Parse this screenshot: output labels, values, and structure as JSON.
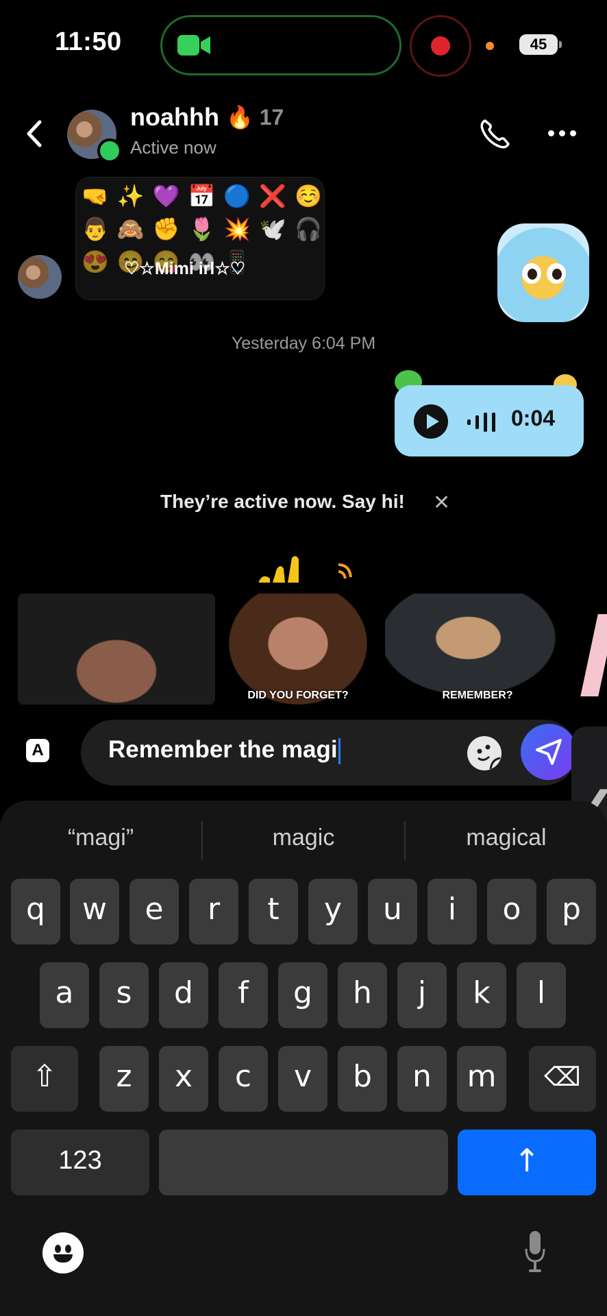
{
  "status_bar": {
    "time": "11:50",
    "battery": "45"
  },
  "header": {
    "name": "noahhh",
    "streak": "🔥 17",
    "status": "Active now"
  },
  "messages": {
    "shared_card_title": "♡☆Mimi irl☆♡",
    "emoji_rows": [
      "🤜✨💜📅🔵❌☺️",
      "👨🙈✊🌷💥🕊️🎧",
      "😍😊😋👀📱"
    ],
    "timestamp": "Yesterday 6:04 PM",
    "voice_duration": "0:04",
    "active_tip": "They’re active now. Say hi!",
    "active_tip_close": "✕"
  },
  "gifs": [
    {
      "caption": ""
    },
    {
      "caption": "DID YOU FORGET?"
    },
    {
      "caption": "REMEMBER?"
    }
  ],
  "compose": {
    "format_label": "A",
    "text": "Remember the magi"
  },
  "keyboard": {
    "suggestions": [
      "“magi”",
      "magic",
      "magical"
    ],
    "row1": [
      "q",
      "w",
      "e",
      "r",
      "t",
      "y",
      "u",
      "i",
      "o",
      "p"
    ],
    "row2": [
      "a",
      "s",
      "d",
      "f",
      "g",
      "h",
      "j",
      "k",
      "l"
    ],
    "row3": [
      "z",
      "x",
      "c",
      "v",
      "b",
      "n",
      "m"
    ],
    "numbers_label": "123",
    "shift_glyph": "⇧",
    "delete_glyph": "⌫",
    "return_glyph": "↑"
  },
  "colors": {
    "accent": "#0a6cff",
    "online": "#2ecc5b",
    "voice_bubble": "#9edcf7",
    "record": "#e0242c"
  }
}
